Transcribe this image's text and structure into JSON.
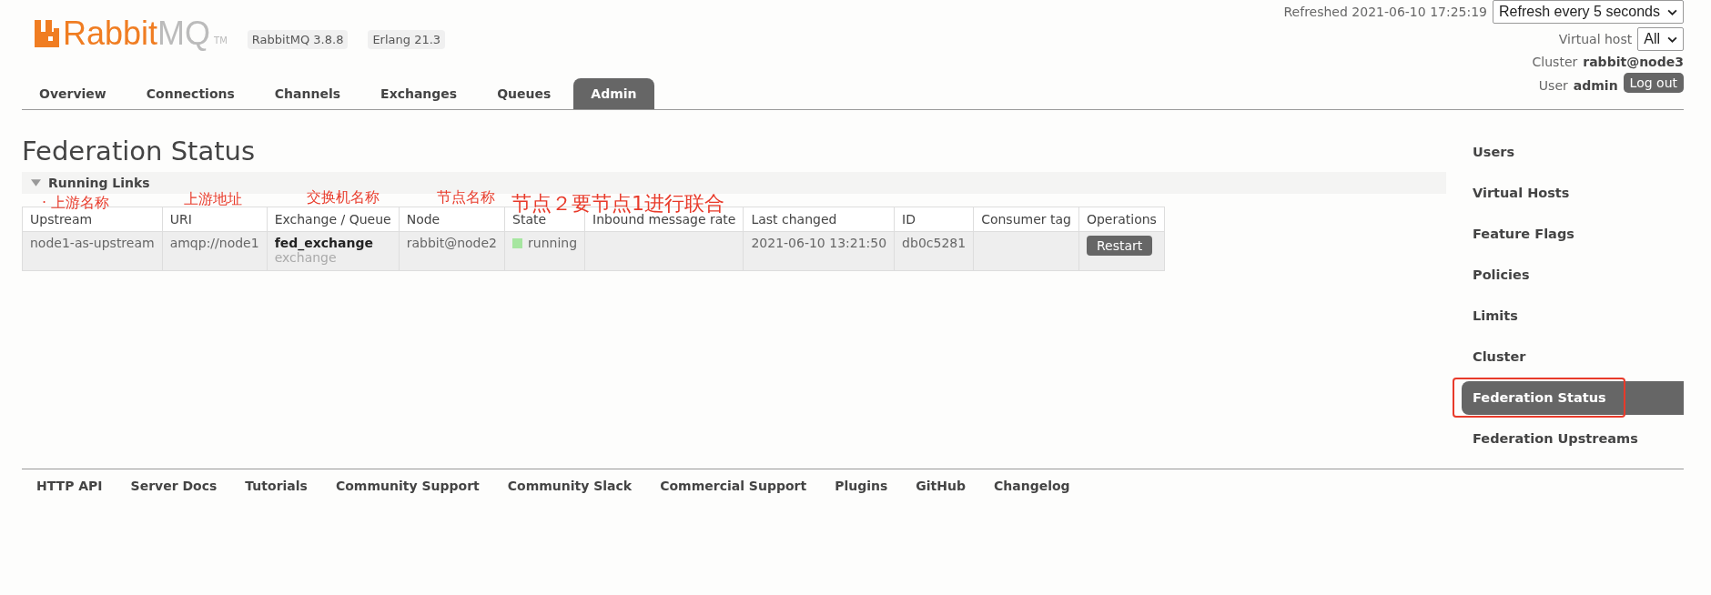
{
  "header": {
    "logo": {
      "primary": "Rabbit",
      "secondary": "MQ",
      "mark": "TM"
    },
    "versions": [
      "RabbitMQ 3.8.8",
      "Erlang 21.3"
    ],
    "refreshed": "Refreshed 2021-06-10 17:25:19",
    "refresh_select": "Refresh every 5 seconds",
    "virtual_host": {
      "label": "Virtual host",
      "value": "All"
    },
    "cluster": {
      "label": "Cluster",
      "value": "rabbit@node3"
    },
    "user": {
      "label": "User",
      "value": "admin"
    },
    "logout": "Log out"
  },
  "tabs": [
    {
      "label": "Overview",
      "selected": false
    },
    {
      "label": "Connections",
      "selected": false
    },
    {
      "label": "Channels",
      "selected": false
    },
    {
      "label": "Exchanges",
      "selected": false
    },
    {
      "label": "Queues",
      "selected": false
    },
    {
      "label": "Admin",
      "selected": true
    }
  ],
  "page_title": "Federation Status",
  "section": {
    "title": "Running Links",
    "expanded": true,
    "annotations": [
      "· 上游名称",
      "上游地址",
      "交换机名称",
      "节点名称",
      "节点２要节点1进行联合"
    ],
    "table": {
      "columns": [
        "Upstream",
        "URI",
        "Exchange / Queue",
        "Node",
        "State",
        "Inbound message rate",
        "Last changed",
        "ID",
        "Consumer tag",
        "Operations"
      ],
      "rows": [
        {
          "cells": [
            {
              "kind": "text",
              "text": "node1-as-upstream"
            },
            {
              "kind": "text",
              "text": "amqp://node1"
            },
            {
              "kind": "exchange",
              "name": "fed_exchange",
              "type": "exchange"
            },
            {
              "kind": "text",
              "text": "rabbit@node2"
            },
            {
              "kind": "state",
              "text": "running",
              "color": "#a6e6a0"
            },
            {
              "kind": "empty"
            },
            {
              "kind": "text",
              "text": "2021-06-10 13:21:50"
            },
            {
              "kind": "text",
              "text": "db0c5281"
            },
            {
              "kind": "empty"
            },
            {
              "kind": "button",
              "text": "Restart"
            }
          ]
        }
      ]
    }
  },
  "sidebar": {
    "items": [
      {
        "label": "Users",
        "selected": false
      },
      {
        "label": "Virtual Hosts",
        "selected": false
      },
      {
        "label": "Feature Flags",
        "selected": false
      },
      {
        "label": "Policies",
        "selected": false
      },
      {
        "label": "Limits",
        "selected": false
      },
      {
        "label": "Cluster",
        "selected": false
      },
      {
        "label": "Federation Status",
        "selected": true,
        "highlighted": true
      },
      {
        "label": "Federation Upstreams",
        "selected": false
      }
    ]
  },
  "footer": {
    "links": [
      "HTTP API",
      "Server Docs",
      "Tutorials",
      "Community Support",
      "Community Slack",
      "Commercial Support",
      "Plugins",
      "GitHub",
      "Changelog"
    ]
  }
}
